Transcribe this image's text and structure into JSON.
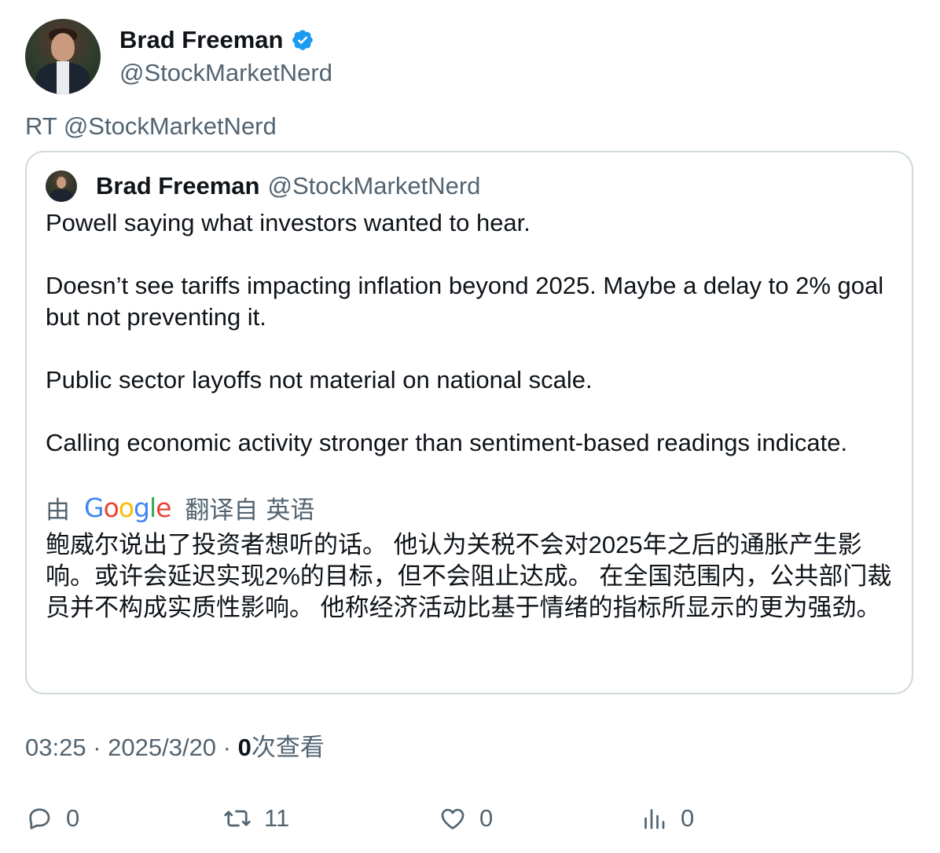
{
  "author": {
    "display_name": "Brad Freeman",
    "handle": "@StockMarketNerd",
    "verified": true
  },
  "retweet_line": "RT @StockMarketNerd",
  "quoted_tweet": {
    "display_name": "Brad Freeman",
    "handle": "@StockMarketNerd",
    "paragraphs": [
      "Powell saying what investors wanted to hear.",
      "Doesn’t see tariffs impacting inflation beyond 2025. Maybe a delay to 2% goal but not preventing it.",
      "Public sector layoffs not material on national scale.",
      "Calling economic activity stronger than sentiment-based readings indicate."
    ],
    "translation": {
      "prefix": "由",
      "provider_letters": [
        "G",
        "o",
        "o",
        "g",
        "l",
        "e"
      ],
      "suffix": "翻译自",
      "language": "英语",
      "text": "鲍威尔说出了投资者想听的话。 他认为关税不会对2025年之后的通胀产生影响。或许会延迟实现2%的目标，但不会阻止达成。 在全国范围内，公共部门裁员并不构成实质性影响。 他称经济活动比基于情绪的指标所显示的更为强劲。"
    }
  },
  "meta": {
    "time": "03:25",
    "separator": " · ",
    "date": "2025/3/20",
    "views_count": "0",
    "views_label": "次查看"
  },
  "actions": {
    "replies": "0",
    "retweets": "11",
    "likes": "0",
    "views": "0"
  },
  "colors": {
    "text_primary": "#0f1419",
    "text_secondary": "#536471",
    "border": "#cfd9de",
    "verified": "#1d9bf0"
  }
}
